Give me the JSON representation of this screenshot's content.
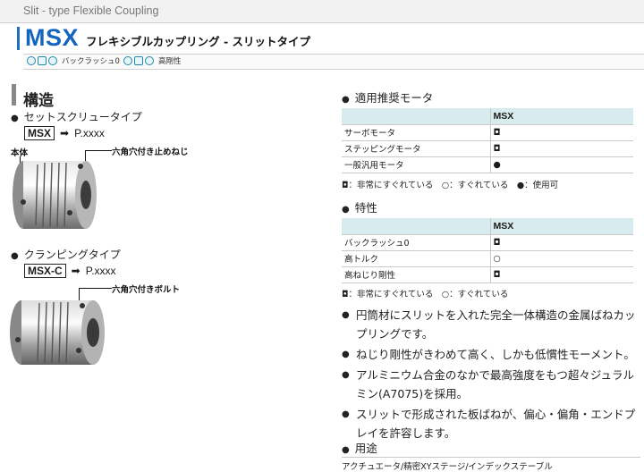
{
  "header": {
    "subtitle": "Slit - type Flexible Coupling",
    "series": "MSX",
    "title_jp": "フレキシブルカップリング - スリットタイプ",
    "features": [
      {
        "icon": "zero-backlash-icon",
        "label": "バックラッシュ0"
      },
      {
        "icon": "high-rigidity-icon",
        "label": "高剛性"
      }
    ]
  },
  "structure": {
    "heading": "構造",
    "type1": {
      "label": "セットスクリュータイプ",
      "model": "MSX",
      "page": "P.xxxx",
      "callout_body": "本体",
      "callout_screw": "六角穴付き止めねじ"
    },
    "type2": {
      "label": "クランピングタイプ",
      "model": "MSX-C",
      "page": "P.xxxx",
      "callout_bolt": "六角穴付きボルト"
    }
  },
  "motors": {
    "heading": "適用推奨モータ",
    "col": "MSX",
    "rows": [
      {
        "name": "サーボモータ",
        "mark": "◘"
      },
      {
        "name": "ステッピングモータ",
        "mark": "◘"
      },
      {
        "name": "一般汎用モータ",
        "mark": "●"
      }
    ],
    "legend": "◘：非常にすぐれている　○：すぐれている　●：使用可"
  },
  "characteristics": {
    "heading": "特性",
    "col": "MSX",
    "rows": [
      {
        "name": "バックラッシュ0",
        "mark": "◘"
      },
      {
        "name": "高トルク",
        "mark": "○"
      },
      {
        "name": "高ねじり剛性",
        "mark": "◘"
      }
    ],
    "legend": "◘：非常にすぐれている　○：すぐれている"
  },
  "description": [
    "円筒材にスリットを入れた完全一体構造の金属ばねカップリングです。",
    "ねじり剛性がきわめて高く、しかも低慣性モーメント。",
    "アルミニウム合金のなかで最高強度をもつ超々ジュラルミン(A7075)を採用。",
    "スリットで形成された板ばねが、偏心・偏角・エンドプレイを許容します。"
  ],
  "usage": {
    "heading": "用途",
    "text": "アクチュエータ/精密XYステージ/インデックステーブル"
  },
  "colors": {
    "brand_blue": "#1565c0",
    "table_header": "#d8ecef"
  }
}
